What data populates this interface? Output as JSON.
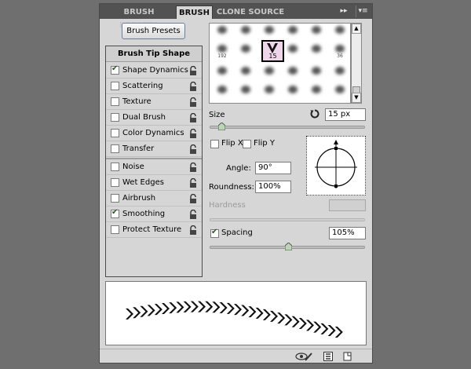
{
  "tabs": [
    {
      "label": "BRUSH PRESETS"
    },
    {
      "label": "BRUSH"
    },
    {
      "label": "CLONE SOURCE"
    }
  ],
  "panel_menu": {
    "expand": "▸▸",
    "menu": "▾≡"
  },
  "brush_presets_button": "Brush Presets",
  "options_header": "Brush Tip Shape",
  "options": [
    {
      "label": "Shape Dynamics",
      "checked": true
    },
    {
      "label": "Scattering",
      "checked": false
    },
    {
      "label": "Texture",
      "checked": false
    },
    {
      "label": "Dual Brush",
      "checked": false
    },
    {
      "label": "Color Dynamics",
      "checked": false
    },
    {
      "label": "Transfer",
      "checked": false
    },
    {
      "label": "Noise",
      "checked": false
    },
    {
      "label": "Wet Edges",
      "checked": false
    },
    {
      "label": "Airbrush",
      "checked": false
    },
    {
      "label": "Smoothing",
      "checked": true
    },
    {
      "label": "Protect Texture",
      "checked": false
    }
  ],
  "tip_grid": {
    "rows": [
      [
        "",
        "",
        "",
        "",
        "",
        ""
      ],
      [
        "192",
        "",
        "",
        "",
        "",
        "36"
      ],
      [
        "",
        "",
        "",
        "",
        "",
        ""
      ],
      [
        "",
        "",
        "",
        "",
        "",
        ""
      ],
      [
        "",
        "",
        "",
        "",
        "",
        ""
      ]
    ],
    "selected": {
      "row": 1,
      "col": 2,
      "size": "15"
    }
  },
  "size": {
    "label": "Size",
    "value": "15 px",
    "slider_fraction": 0.07
  },
  "flip_x": {
    "label": "Flip X",
    "checked": false
  },
  "flip_y": {
    "label": "Flip Y",
    "checked": false
  },
  "angle": {
    "label": "Angle:",
    "value": "90°"
  },
  "roundness": {
    "label": "Roundness:",
    "value": "100%"
  },
  "hardness": {
    "label": "Hardness",
    "value": "",
    "disabled": true
  },
  "spacing": {
    "label": "Spacing",
    "checked": true,
    "value": "105%",
    "slider_fraction": 0.5
  },
  "colors": {
    "tab_bar": "#525252",
    "panel": "#d6d6d6",
    "selected_tip": "#efd5ea"
  }
}
